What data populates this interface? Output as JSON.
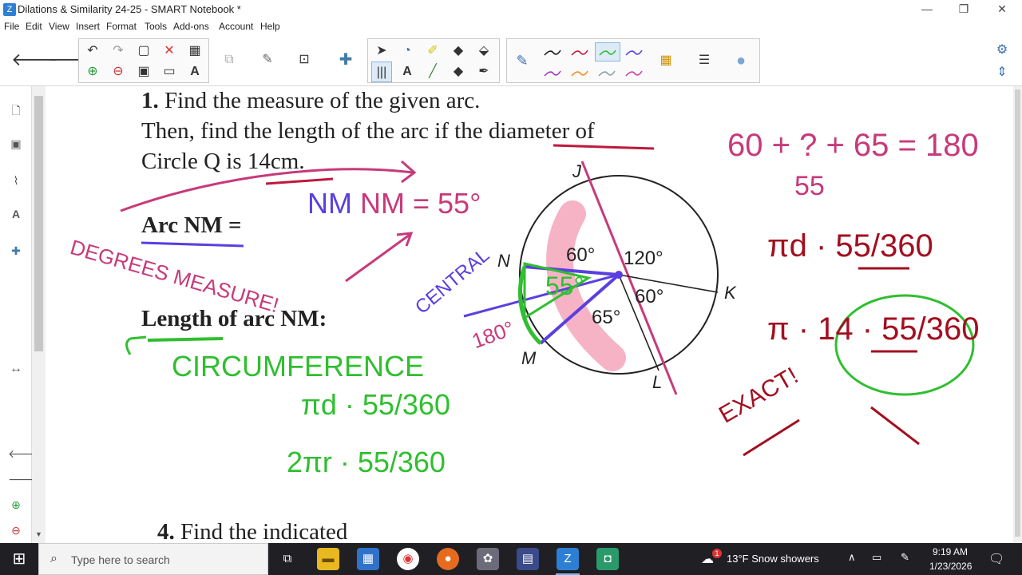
{
  "window": {
    "title": "Dilations & Similarity 24-25 - SMART Notebook *",
    "minimize": "—",
    "restore": "❐",
    "close": "✕"
  },
  "menu": [
    "File",
    "Edit",
    "View",
    "Insert",
    "Format",
    "Tools",
    "Add-ons",
    "Account",
    "Help"
  ],
  "colors": {
    "pen_black": "#1a1a1a",
    "pen_red": "#c0183c",
    "pen_green": "#2fbf2f",
    "pen_blue": "#5a3fe0",
    "pen_magenta": "#c73a7a",
    "pen_darkred": "#a30f1f",
    "pink_highlight": "#f6b3c6",
    "taskbar_bg": "#1f1f24"
  },
  "document": {
    "q1_number": "1.",
    "q1_line1": "Find the measure of the given arc.",
    "q1_line2": "Then, find the length of the arc if the diameter of",
    "q1_line3": "Circle Q is 14cm.",
    "arc_label": "Arc NM =",
    "length_label": "Length of arc NM:",
    "q4_number": "4.",
    "q4_text": "Find the indicated"
  },
  "diagram": {
    "points": [
      "J",
      "N",
      "K",
      "M",
      "L"
    ],
    "angles": [
      "60°",
      "120°",
      "60°",
      "65°"
    ]
  },
  "ink": {
    "nm_eq": "NM = 55°",
    "degrees_measure": "DEGREES MEASURE!",
    "central": "CENTRAL",
    "deg180": "180°",
    "fiftyfive_mark": "55°",
    "circumference": "CIRCUMFERENCE",
    "formula1": "πd · 55/360",
    "formula2": "2πr · 55/360",
    "eq_top": "60 + ? + 65 = 180",
    "eq_55": "55",
    "right_f1": "πd · 55/360",
    "right_f2": "π · 14 · 55/360",
    "exact": "EXACT!"
  },
  "taskbar": {
    "search_placeholder": "Type here to search",
    "weather": "13°F  Snow showers",
    "weather_badge": "1",
    "time": "9:19 AM",
    "date": "1/23/2026"
  }
}
